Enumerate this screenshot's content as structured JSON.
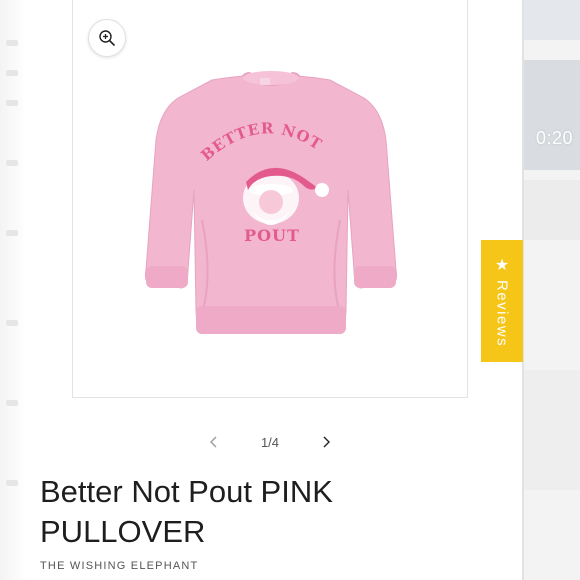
{
  "video": {
    "time": "0:20"
  },
  "gallery": {
    "counter": "1/4",
    "zoom_icon": "zoom-in-icon",
    "prev_icon": "chevron-left-icon",
    "next_icon": "chevron-right-icon"
  },
  "product": {
    "print_line1": "BETTER NOT",
    "print_line2": "POUT",
    "title": "Better Not Pout PINK PULLOVER",
    "vendor": "THE WISHING ELEPHANT"
  },
  "reviews_tab": {
    "label": "Reviews",
    "icon": "star-icon",
    "color": "#f5c518"
  },
  "colors": {
    "sweater": "#f2b6cf",
    "sweater_shade": "#e9a3c1",
    "print": "#e35b8c",
    "text": "#1e1e1e"
  }
}
